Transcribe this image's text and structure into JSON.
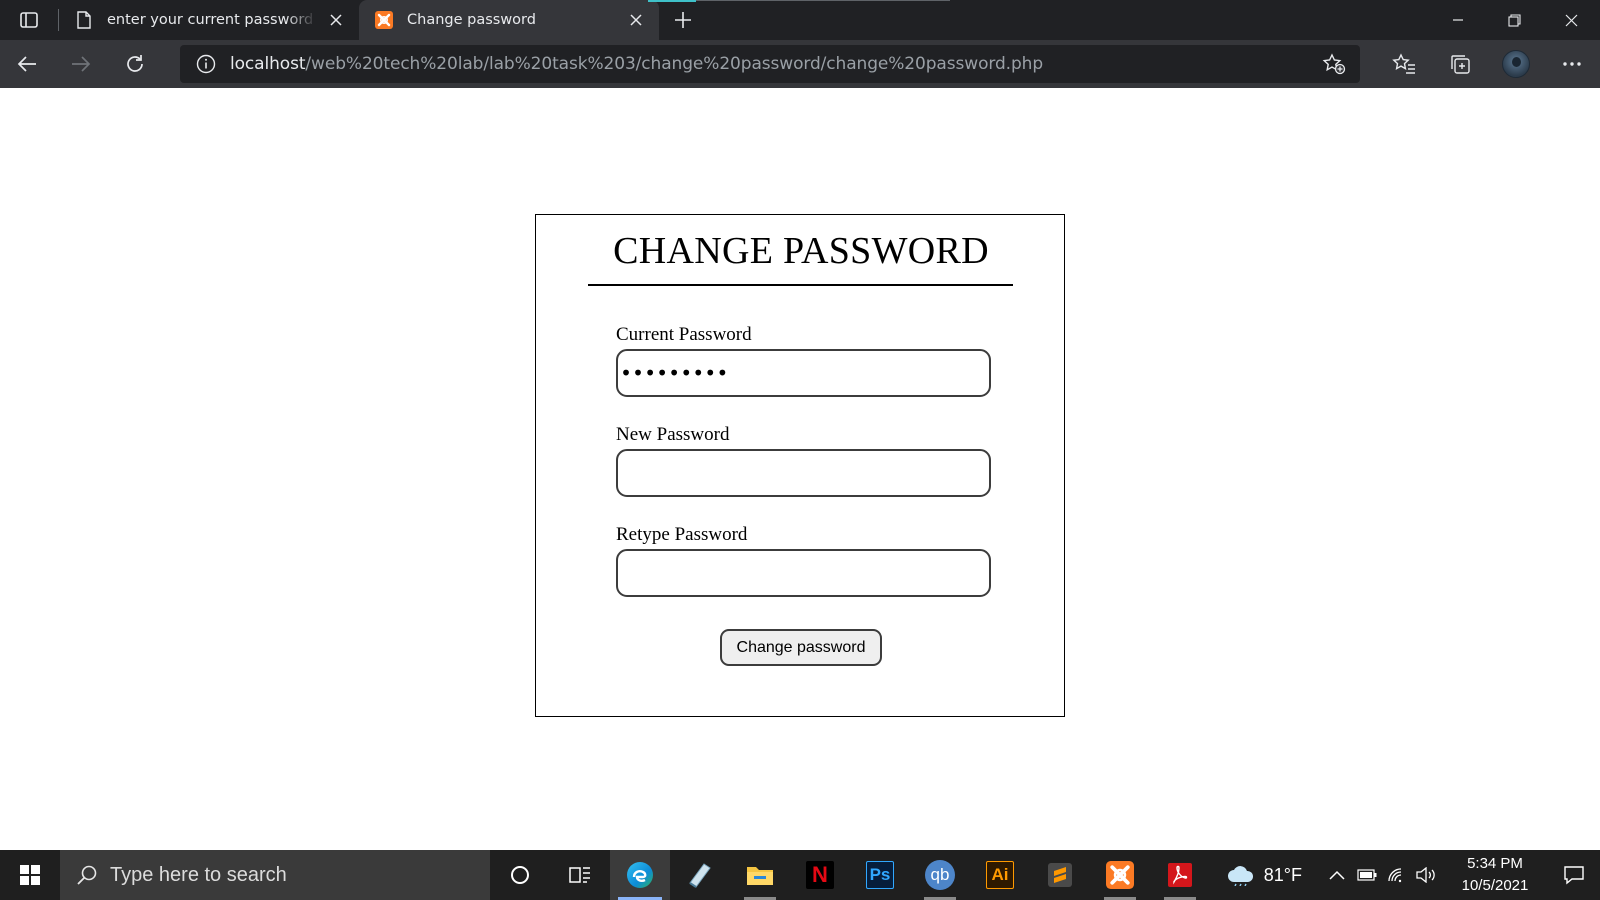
{
  "browser": {
    "tabs": [
      {
        "title": "enter your current password and",
        "icon": "page-icon",
        "active": false
      },
      {
        "title": "Change password",
        "icon": "xampp-icon",
        "active": true
      }
    ],
    "address": {
      "host": "localhost",
      "path": "/web%20tech%20lab/lab%20task%203/change%20password/change%20password.php"
    }
  },
  "form": {
    "title": "CHANGE PASSWORD",
    "fields": [
      {
        "label": "Current Password",
        "value": "•••••••••"
      },
      {
        "label": "New Password",
        "value": ""
      },
      {
        "label": "Retype Password",
        "value": ""
      }
    ],
    "submit_label": "Change password"
  },
  "taskbar": {
    "search_placeholder": "Type here to search",
    "apps": [
      {
        "name": "cortana",
        "active": false
      },
      {
        "name": "task-view",
        "active": false
      },
      {
        "name": "edge",
        "active": true
      },
      {
        "name": "notes",
        "active": false
      },
      {
        "name": "file-explorer",
        "active": false
      },
      {
        "name": "netflix",
        "label": "N",
        "active": false
      },
      {
        "name": "photoshop",
        "label": "Ps",
        "active": false
      },
      {
        "name": "qbittorrent",
        "label": "qb",
        "active": false
      },
      {
        "name": "illustrator",
        "label": "Ai",
        "active": false
      },
      {
        "name": "sublime-text",
        "active": false
      },
      {
        "name": "xampp",
        "active": false
      },
      {
        "name": "acrobat",
        "active": false
      }
    ],
    "weather": {
      "temp": "81°F"
    },
    "time": "5:34 PM",
    "date": "10/5/2021"
  },
  "colors": {
    "chrome_dark": "#202124",
    "chrome_toolbar": "#35363a",
    "taskbar": "#1f1f1f",
    "xampp": "#fb7a24",
    "accent": "#8ab4f8"
  }
}
